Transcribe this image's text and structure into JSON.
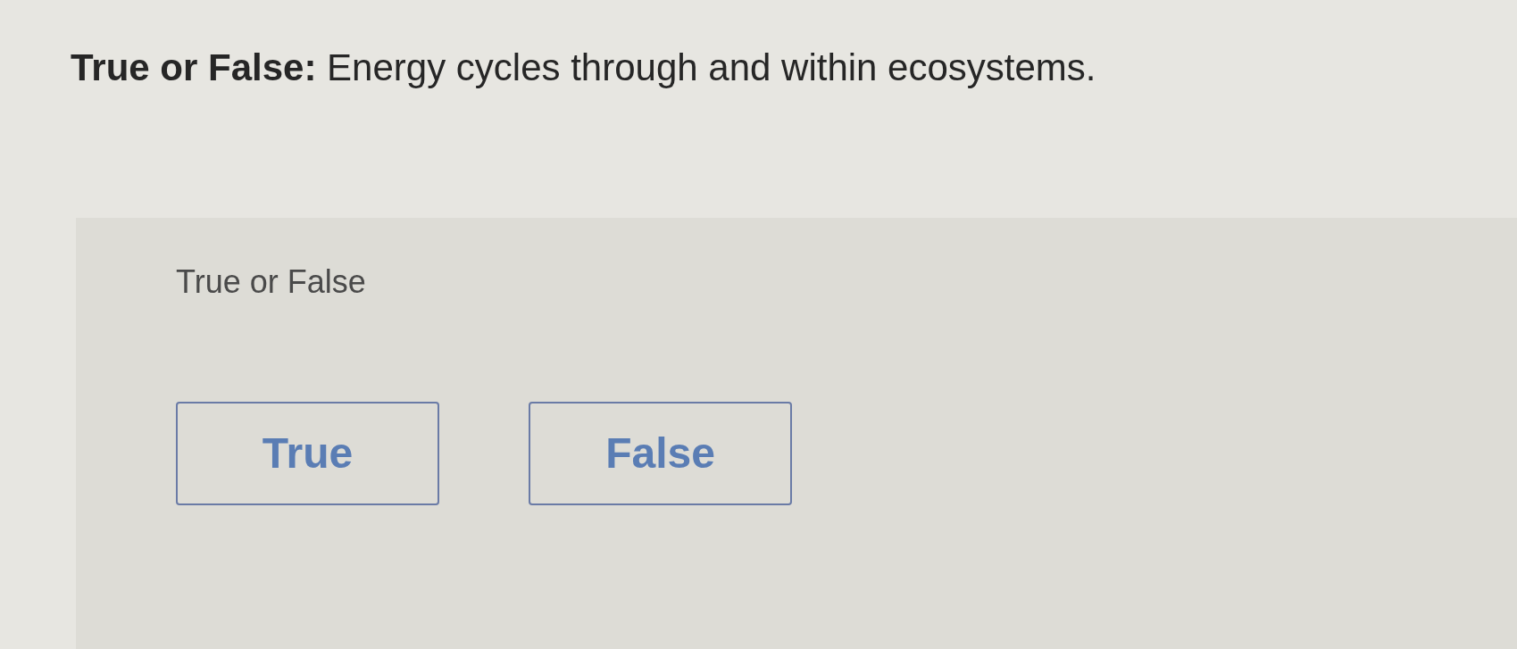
{
  "question": {
    "text": "**True or False:** Energy cycles through and within ecosystems."
  },
  "answer_panel": {
    "prompt": "True or False",
    "options": [
      {
        "label": "True",
        "selected": false
      },
      {
        "label": "False",
        "selected": false
      }
    ]
  }
}
